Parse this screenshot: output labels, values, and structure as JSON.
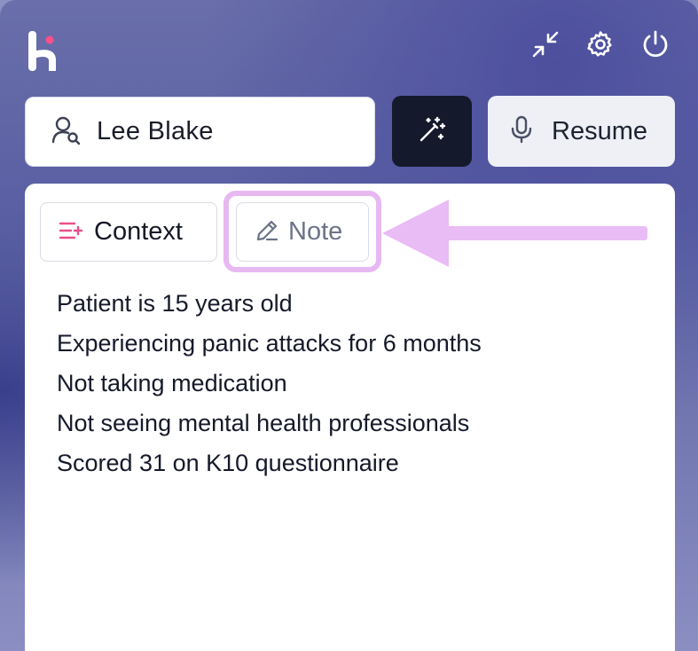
{
  "header": {
    "icons": [
      "logo",
      "minimize-icon",
      "gear-icon",
      "power-icon"
    ]
  },
  "search": {
    "value": "Lee Blake",
    "icon": "user-search-icon"
  },
  "actions": {
    "magic_icon": "magic-wand-icon",
    "resume_label": "Resume",
    "resume_icon": "microphone-icon"
  },
  "tabs": [
    {
      "label": "Context",
      "icon": "list-add-icon",
      "active": true
    },
    {
      "label": "Note",
      "icon": "pencil-icon",
      "active": false
    }
  ],
  "notes": {
    "lines": [
      "Patient is 15 years old",
      "Experiencing panic attacks for 6 months",
      "Not taking medication",
      "Not seeing mental health professionals",
      "Scored 31 on K10 questionnaire"
    ]
  },
  "colors": {
    "accent_pink": "#e94f8a",
    "highlight": "#e7b8f2",
    "dark_button": "#141a2c"
  }
}
